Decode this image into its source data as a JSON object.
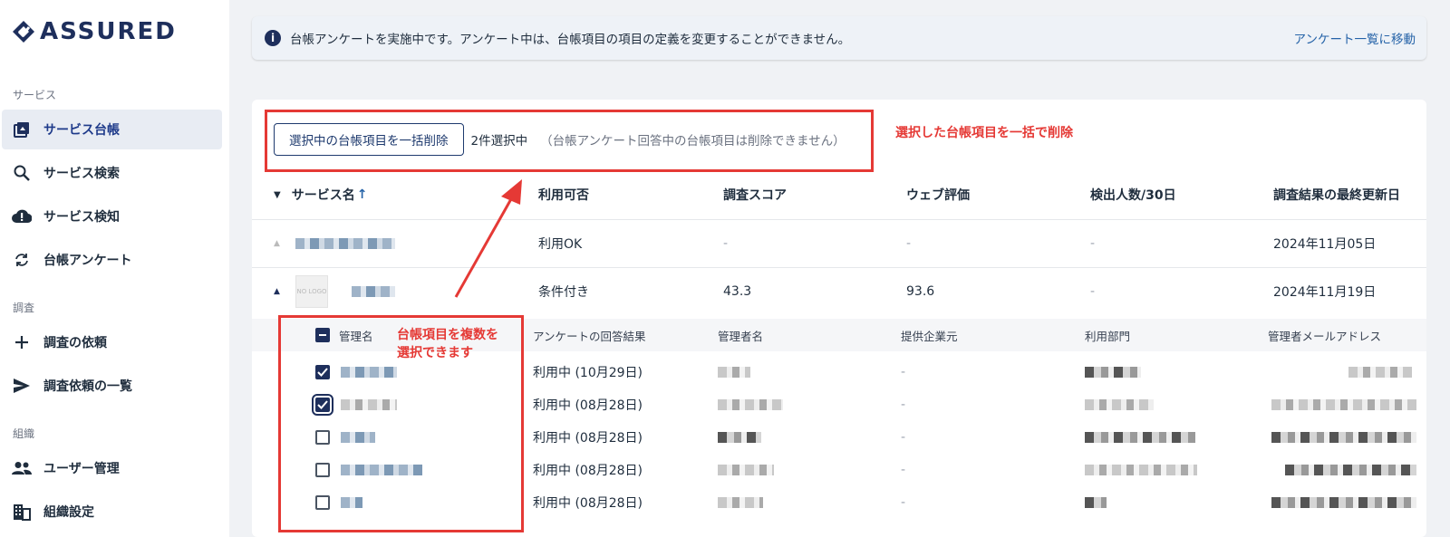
{
  "app": {
    "brand": "ASSURED"
  },
  "sidebar": {
    "sections": [
      {
        "label": "サービス"
      },
      {
        "label": "調査"
      },
      {
        "label": "組織"
      }
    ],
    "items": [
      {
        "label": "サービス台帳",
        "icon": "ledger-icon"
      },
      {
        "label": "サービス検索",
        "icon": "search-icon"
      },
      {
        "label": "サービス検知",
        "icon": "cloud-alert-icon"
      },
      {
        "label": "台帳アンケート",
        "icon": "sync-icon"
      },
      {
        "label": "調査の依頼",
        "icon": "plus-icon"
      },
      {
        "label": "調査依頼の一覧",
        "icon": "send-icon"
      },
      {
        "label": "ユーザー管理",
        "icon": "users-icon"
      },
      {
        "label": "組織設定",
        "icon": "building-icon"
      }
    ]
  },
  "banner": {
    "message": "台帳アンケートを実施中です。アンケート中は、台帳項目の項目の定義を変更することができません。",
    "link": "アンケート一覧に移動"
  },
  "toolbar": {
    "bulk_delete_label": "選択中の台帳項目を一括削除",
    "selected_count": "2件選択中",
    "note": "（台帳アンケート回答中の台帳項目は削除できません）"
  },
  "annotations": {
    "bulk_delete": "選択した台帳項目を一括で削除",
    "multi_select_line1": "台帳項目を複数を",
    "multi_select_line2": "選択できます"
  },
  "table": {
    "columns": [
      "サービス名",
      "利用可否",
      "調査スコア",
      "ウェブ評価",
      "検出人数/30日",
      "調査結果の最終更新日"
    ],
    "sort_arrow": "↑",
    "rows": [
      {
        "availability": "利用OK",
        "score": "-",
        "web": "-",
        "detected": "-",
        "updated": "2024年11月05日"
      },
      {
        "availability": "条件付き",
        "score": "43.3",
        "web": "93.6",
        "detected": "-",
        "updated": "2024年11月19日"
      }
    ],
    "nologo": "NO LOGO",
    "sub_columns": [
      "管理名",
      "アンケートの回答結果",
      "管理者名",
      "提供企業元",
      "利用部門",
      "管理者メールアドレス"
    ],
    "sub_rows": [
      {
        "checked": true,
        "answer": "利用中 (10月29日)",
        "vendor": "-"
      },
      {
        "checked": true,
        "answer": "利用中 (08月28日)",
        "vendor": "-"
      },
      {
        "checked": false,
        "answer": "利用中 (08月28日)",
        "vendor": "-"
      },
      {
        "checked": false,
        "answer": "利用中 (08月28日)",
        "vendor": "-"
      },
      {
        "checked": false,
        "answer": "利用中 (08月28日)",
        "vendor": "-"
      }
    ]
  },
  "colors": {
    "accent": "#1e2f5c",
    "annotation": "#e53935",
    "link": "#2563a8"
  }
}
